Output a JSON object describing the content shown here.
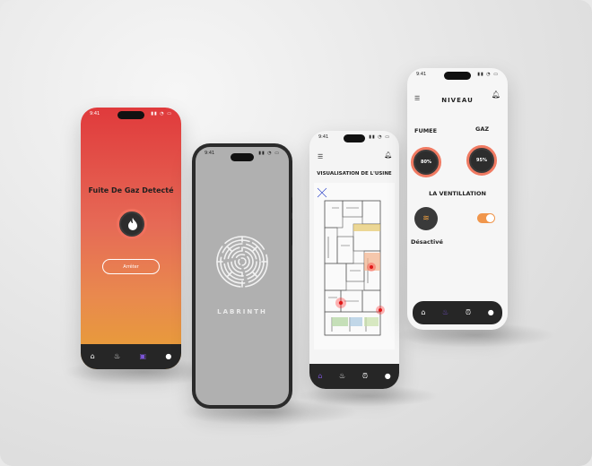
{
  "phone_alert": {
    "time": "9:41",
    "title": "Fuite De Gaz Detecté",
    "button_label": "Arrêter",
    "nav": [
      "home-icon",
      "flame-icon",
      "alarm-clock-icon",
      "user-icon"
    ]
  },
  "phone_labyrinth": {
    "time": "9:41",
    "brand": "LABRINTH"
  },
  "phone_visualisation": {
    "time": "9:41",
    "title": "VISUALISATION DE L'USINE",
    "nav": [
      "home-icon",
      "flame-icon",
      "alarm-clock-icon",
      "user-icon"
    ]
  },
  "phone_niveau": {
    "time": "9:41",
    "title": "NIVEAU",
    "smoke_label": "FUMEE",
    "smoke_value": "80%",
    "gas_label": "GAZ",
    "gas_value": "95%",
    "ventilation_title": "LA VENTILLATION",
    "ventilation_status": "Désactivé",
    "nav": [
      "home-icon",
      "flame-icon",
      "alarm-clock-icon",
      "user-icon"
    ]
  },
  "colors": {
    "alert_top": "#e03a3c",
    "alert_bottom": "#e7a233",
    "accent_purple": "#7c55d6",
    "ring_orange": "#f07a62",
    "navbar": "#262626"
  }
}
